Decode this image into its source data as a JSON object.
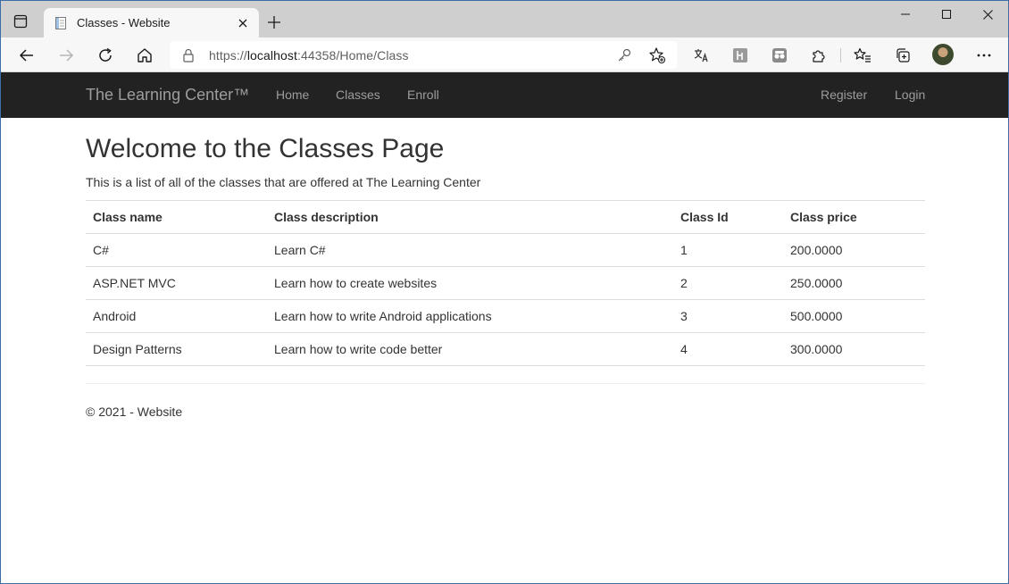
{
  "browser": {
    "tab_title": "Classes - Website",
    "url_scheme": "https://",
    "url_host": "localhost",
    "url_rest": ":44358/Home/Class",
    "new_tab_symbol": "+",
    "close_symbol": "✕",
    "more_symbol": "···"
  },
  "navbar": {
    "brand": "The Learning Center™",
    "links": [
      "Home",
      "Classes",
      "Enroll"
    ],
    "register": "Register",
    "login": "Login"
  },
  "page": {
    "title": "Welcome to the Classes Page",
    "lead": "This is a list of all of the classes that are offered at The Learning Center"
  },
  "table": {
    "headers": [
      "Class name",
      "Class description",
      "Class Id",
      "Class price"
    ],
    "rows": [
      [
        "C#",
        "Learn C#",
        "1",
        "200.0000"
      ],
      [
        "ASP.NET MVC",
        "Learn how to create websites",
        "2",
        "250.0000"
      ],
      [
        "Android",
        "Learn how to write Android applications",
        "3",
        "500.0000"
      ],
      [
        "Design Patterns",
        "Learn how to write code better",
        "4",
        "300.0000"
      ]
    ]
  },
  "footer": {
    "text": "© 2021 - Website"
  },
  "colors": {
    "navbar_bg": "#222222",
    "navbar_text": "#9d9d9d",
    "tabstrip_bg": "#cfcfcf",
    "toolbar_bg": "#f7f7f7"
  }
}
